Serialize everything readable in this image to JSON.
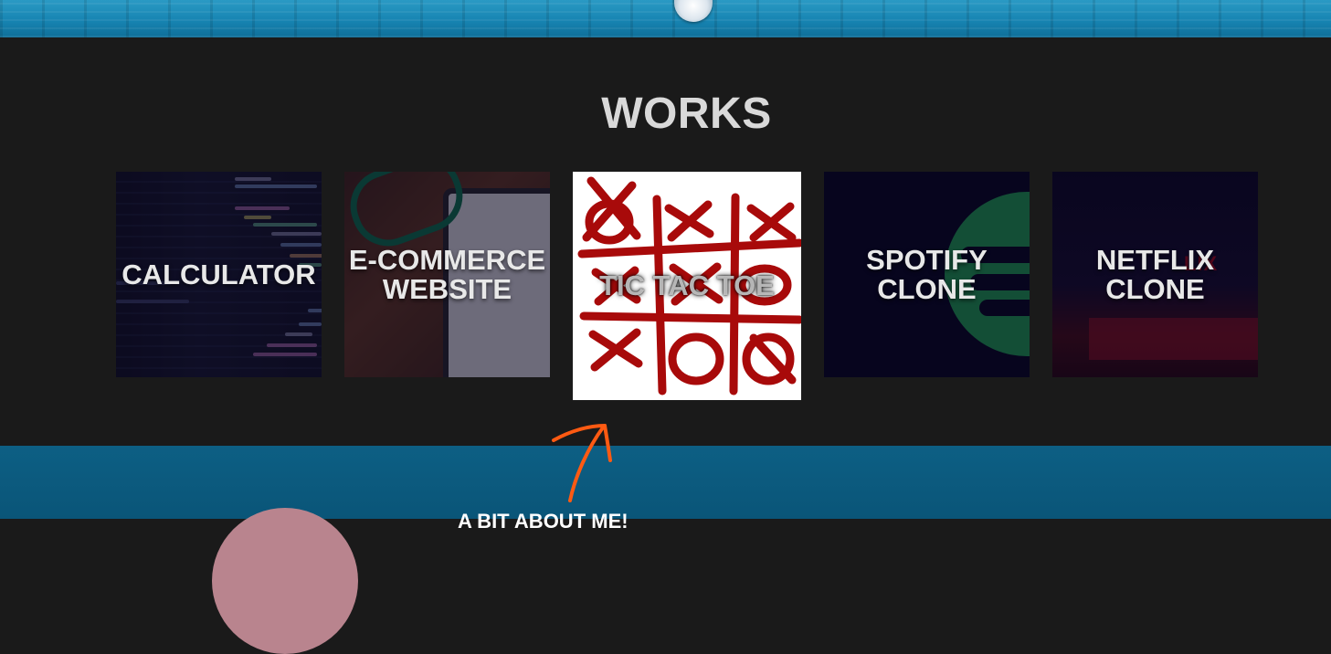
{
  "header": {
    "strip_color": "#1784b2",
    "ornament_icon": "lightbulb-icon"
  },
  "works": {
    "title": "WORKS",
    "cards": [
      {
        "label": "CALCULATOR",
        "theme": "code-editor"
      },
      {
        "label": "E-COMMERCE\nWEBSITE",
        "theme": "tablet-landing-page"
      },
      {
        "label": "TIC TAC TOE",
        "theme": "tic-tac-toe-board",
        "hovered": true
      },
      {
        "label": "SPOTIFY\nCLONE",
        "theme": "spotify-logo"
      },
      {
        "label": "NETFLIX\nCLONE",
        "theme": "netflix-logo"
      }
    ]
  },
  "about": {
    "heading": "A BIT ABOUT ME!",
    "background_color": "#0d5f84"
  },
  "annotation": {
    "arrow_icon": "hand-drawn-arrow-icon",
    "arrow_color": "#ff5a12"
  }
}
